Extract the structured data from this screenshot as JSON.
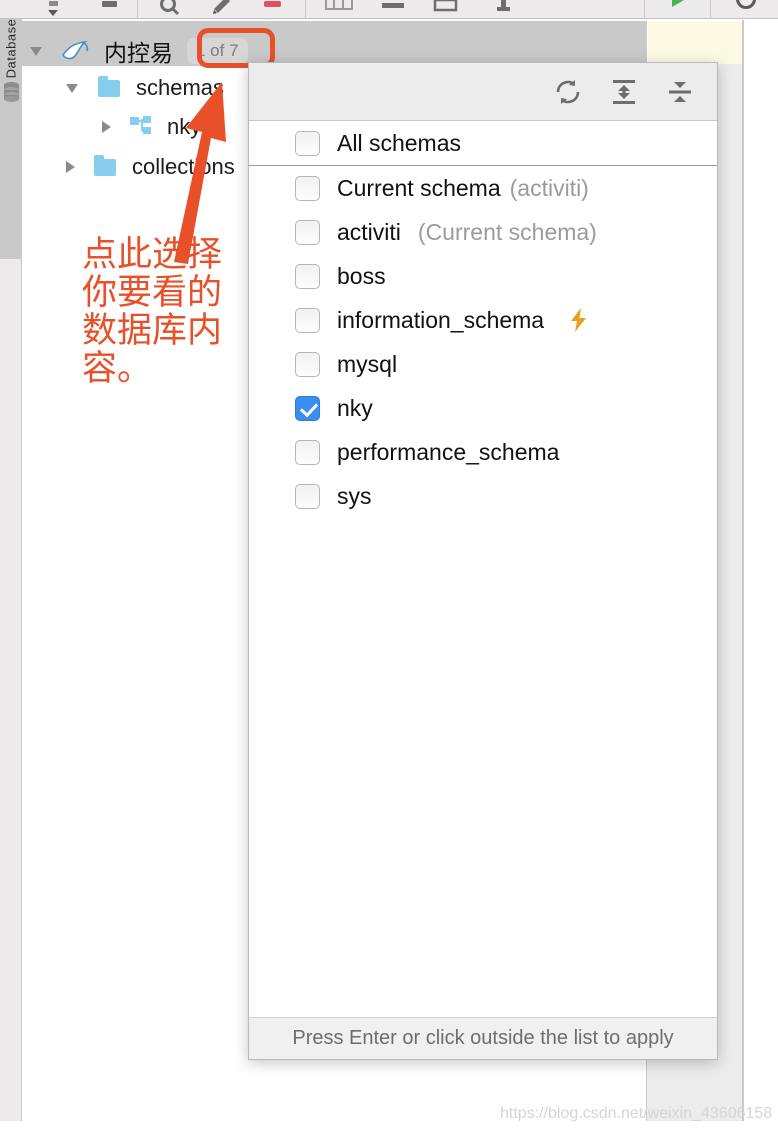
{
  "toolbar": {
    "icons": [
      {
        "name": "dropdown-arrow-icon"
      },
      {
        "name": "stop-icon"
      },
      {
        "name": "search-icon"
      },
      {
        "name": "edit-pencil-icon"
      },
      {
        "name": "record-icon"
      },
      {
        "name": "table-icon"
      },
      {
        "name": "minimize-icon"
      },
      {
        "name": "window-icon"
      },
      {
        "name": "add-icon"
      },
      {
        "name": "run-play-icon"
      },
      {
        "name": "history-icon"
      }
    ]
  },
  "left_strip": {
    "label": "Database",
    "db_icon": "database-cylinder-icon"
  },
  "tree": {
    "root": {
      "label": "内控易",
      "icon": "mysql-dolphin-icon",
      "badge": "1 of 7",
      "expanded": true
    },
    "nodes": [
      {
        "label": "schemas",
        "icon": "folder-icon",
        "expanded": true,
        "indent": 1
      },
      {
        "label": "nky",
        "icon": "schema-diagram-icon",
        "expanded": false,
        "indent": 2
      },
      {
        "label": "collections",
        "icon": "folder-icon",
        "expanded": false,
        "indent": 1
      }
    ]
  },
  "popup": {
    "header_icons": [
      {
        "name": "refresh-icon",
        "title": "Refresh"
      },
      {
        "name": "expand-all-icon",
        "title": "Expand All"
      },
      {
        "name": "collapse-all-icon",
        "title": "Collapse All"
      }
    ],
    "items": [
      {
        "label": "All schemas",
        "sub": "",
        "checked": false,
        "bolt": false,
        "divider": true
      },
      {
        "label": "Current schema",
        "sub": "(activiti)",
        "checked": false,
        "bolt": false,
        "divider": false
      },
      {
        "label": "activiti",
        "sub": "(Current schema)",
        "checked": false,
        "bolt": false,
        "divider": false
      },
      {
        "label": "boss",
        "sub": "",
        "checked": false,
        "bolt": false,
        "divider": false
      },
      {
        "label": "information_schema",
        "sub": "",
        "checked": false,
        "bolt": true,
        "divider": false
      },
      {
        "label": "mysql",
        "sub": "",
        "checked": false,
        "bolt": false,
        "divider": false
      },
      {
        "label": "nky",
        "sub": "",
        "checked": true,
        "bolt": false,
        "divider": false
      },
      {
        "label": "performance_schema",
        "sub": "",
        "checked": false,
        "bolt": false,
        "divider": false
      },
      {
        "label": "sys",
        "sub": "",
        "checked": false,
        "bolt": false,
        "divider": false
      }
    ],
    "footer": "Press Enter or click outside the list to apply"
  },
  "annotation": {
    "text": "点此选择\n你要看的\n数据库内\n容。",
    "arrow": "up-right-arrow-icon",
    "color": "#e8502a"
  },
  "watermark": "https://blog.csdn.net/weixin_43606158",
  "colors": {
    "accent": "#e8502a",
    "checkbox_checked": "#3b8df0",
    "folder": "#87cded",
    "bolt": "#e8a020"
  }
}
